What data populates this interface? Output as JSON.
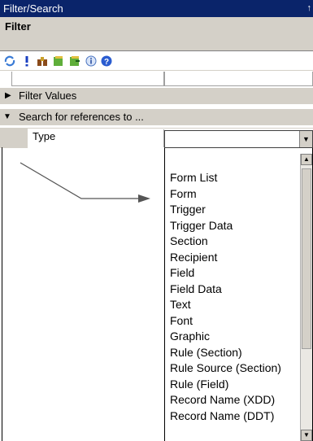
{
  "window": {
    "title": "Filter/Search",
    "pin_glyph": "↑"
  },
  "filter": {
    "label": "Filter"
  },
  "toolbar": {
    "icons": [
      "refresh-icon",
      "exclamation-icon",
      "binoculars-icon",
      "green-book-icon",
      "green-book-arrow-icon",
      "info-icon",
      "help-icon"
    ]
  },
  "sections": {
    "filter_values": "Filter Values",
    "search_refs": "Search for references to ..."
  },
  "type_field": {
    "label": "Type",
    "value": ""
  },
  "dropdown": {
    "options": [
      "Form List",
      "Form",
      "Trigger",
      "Trigger Data",
      "Section",
      "Recipient",
      "Field",
      "Field Data",
      "Text",
      "Font",
      "Graphic",
      "Rule (Section)",
      "Rule Source (Section)",
      "Rule (Field)",
      "Record Name (XDD)",
      "Record Name (DDT)"
    ]
  },
  "colors": {
    "titlebar": "#0a246a",
    "chrome": "#d4d0c8",
    "arrow": "#555555"
  }
}
